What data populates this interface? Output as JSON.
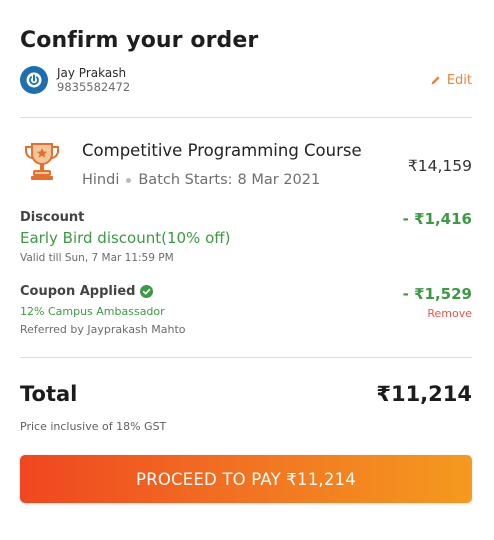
{
  "header": {
    "title": "Confirm your order"
  },
  "user": {
    "name": "Jay Prakash",
    "phone": "9835582472",
    "edit_label": "Edit"
  },
  "course": {
    "name": "Competitive Programming Course",
    "language": "Hindi",
    "batch_label": "Batch Starts:",
    "batch_date": "8 Mar 2021",
    "price": "₹14,159"
  },
  "discount": {
    "label": "Discount",
    "name": "Early Bird discount(10% off)",
    "validity": "Valid till Sun, 7 Mar 11:59 PM",
    "amount": "- ₹1,416"
  },
  "coupon": {
    "label": "Coupon Applied",
    "code": "12% Campus Ambassador",
    "referred_by": "Referred by Jayprakash Mahto",
    "amount": "- ₹1,529",
    "remove_label": "Remove"
  },
  "total": {
    "label": "Total",
    "amount": "₹11,214",
    "gst_note": "Price inclusive of 18% GST"
  },
  "action": {
    "pay_label": "PROCEED TO PAY ₹11,214"
  },
  "colors": {
    "accent_orange": "#e8843f",
    "success_green": "#3c9a44",
    "remove_red": "#e6554a",
    "avatar_blue": "#1f6fb0"
  }
}
